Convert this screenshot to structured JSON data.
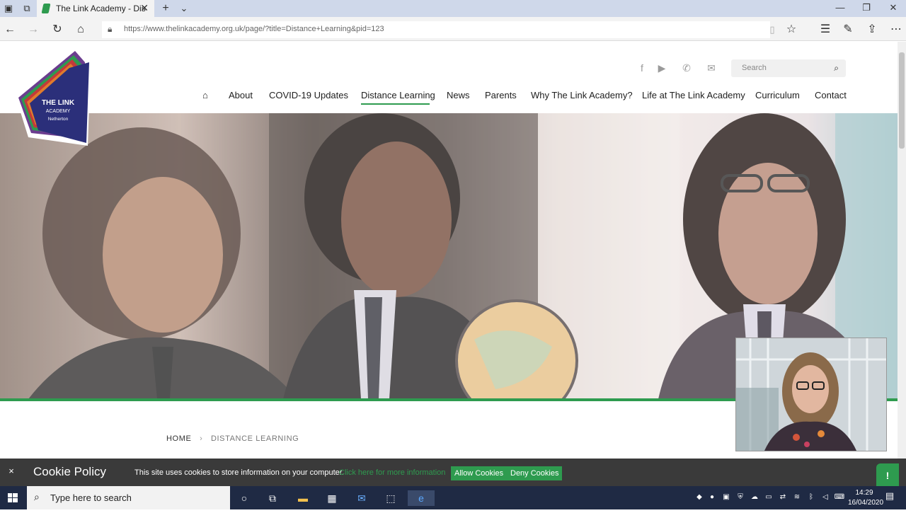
{
  "browser": {
    "tab_title": "The Link Academy - Dis",
    "new_tab": "+",
    "url": "https://www.thelinkacademy.org.uk/page/?title=Distance+Learning&pid=123"
  },
  "site": {
    "logo": {
      "line1": "THE LINK",
      "line2": "ACADEMY",
      "line3": "Netherton",
      "colors": [
        "#2b2f7a",
        "#e07b2c",
        "#c23a3a",
        "#2e9b4f",
        "#6b3d8f"
      ]
    },
    "search_placeholder": "Search",
    "nav": [
      {
        "label": "About"
      },
      {
        "label": "COVID-19 Updates"
      },
      {
        "label": "Distance Learning",
        "active": true
      },
      {
        "label": "News"
      },
      {
        "label": "Parents"
      },
      {
        "label": "Why The Link Academy?"
      },
      {
        "label": "Life at The Link Academy"
      },
      {
        "label": "Curriculum"
      },
      {
        "label": "Contact"
      }
    ],
    "breadcrumb": {
      "home": "HOME",
      "separator": "›",
      "current": "DISTANCE LEARNING"
    },
    "accent_color": "#2e9b4f"
  },
  "cookie": {
    "title": "Cookie Policy",
    "text": "This site uses cookies to store information on your computer.",
    "link": "Click here for more information",
    "allow": "Allow Cookies",
    "deny": "Deny Cookies",
    "close": "×"
  },
  "taskbar": {
    "search_placeholder": "Type here to search",
    "time": "14:29",
    "date": "16/04/2020"
  }
}
